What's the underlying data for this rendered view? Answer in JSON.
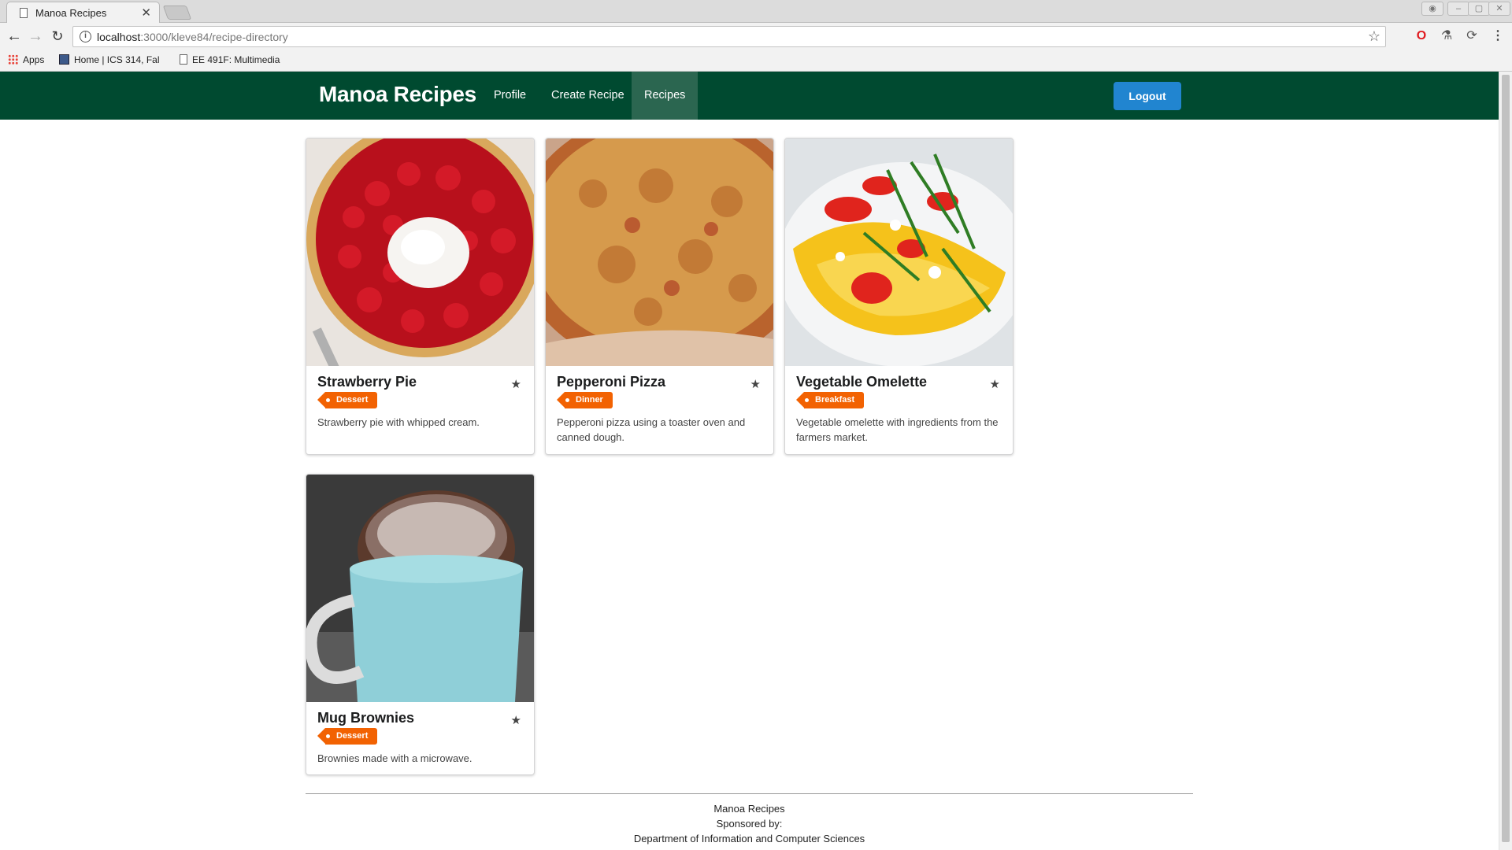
{
  "browser": {
    "tab_title": "Manoa Recipes",
    "tab_close": "✕",
    "url_host": "localhost",
    "url_path": ":3000/kleve84/recipe-directory",
    "bookmarks": [
      {
        "label": "Apps"
      },
      {
        "label": "Home | ICS 314, Fal"
      },
      {
        "label": "EE 491F: Multimedia"
      }
    ]
  },
  "navbar": {
    "brand": "Manoa Recipes",
    "menu": [
      {
        "label": "Profile",
        "active": false
      },
      {
        "label": "Create Recipe",
        "active": false
      },
      {
        "label": "Recipes",
        "active": true
      }
    ],
    "logout_label": "Logout"
  },
  "recipes": [
    {
      "name": "Strawberry Pie",
      "tag": "Dessert",
      "description": "Strawberry pie with whipped cream."
    },
    {
      "name": "Pepperoni Pizza",
      "tag": "Dinner",
      "description": "Pepperoni pizza using a toaster oven and canned dough."
    },
    {
      "name": "Vegetable Omelette",
      "tag": "Breakfast",
      "description": "Vegetable omelette with ingredients from the farmers market."
    },
    {
      "name": "Mug Brownies",
      "tag": "Dessert",
      "description": "Brownies made with a microwave."
    }
  ],
  "footer": {
    "line1": "Manoa Recipes",
    "line2": "Sponsored by:",
    "line3": "Department of Information and Computer Sciences"
  },
  "colors": {
    "navbar": "#004a30",
    "active_menu": "#2b6650",
    "logout": "#2185d0",
    "tag": "#f26202"
  }
}
